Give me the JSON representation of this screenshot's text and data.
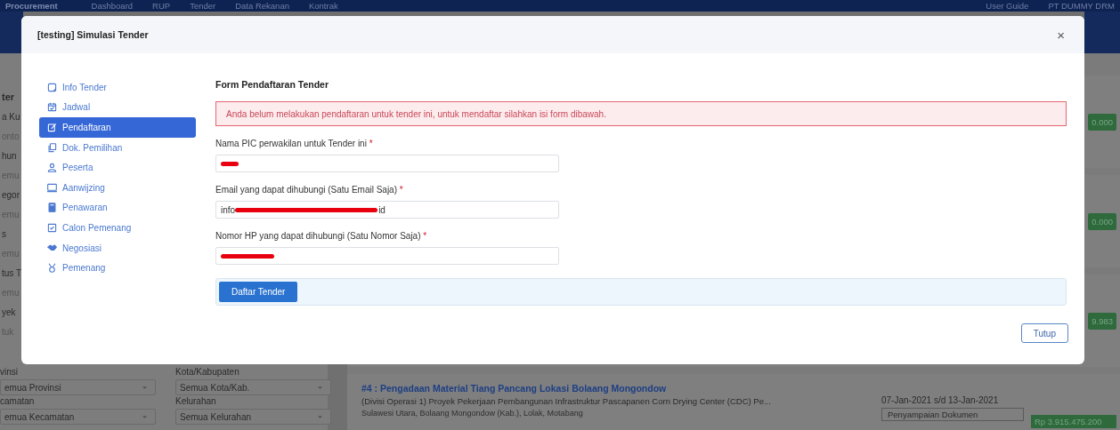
{
  "top_nav": {
    "brand": "Procurement",
    "items": [
      "Dashboard",
      "RUP",
      "Tender",
      "Data Rekanan",
      "Kontrak"
    ],
    "user_guide": "User Guide",
    "user": "PT DUMMY DRM"
  },
  "background": {
    "filter_fragments": [
      {
        "kind": "heading",
        "text": "ter"
      },
      {
        "kind": "label",
        "text": "a Ku"
      },
      {
        "kind": "field",
        "text": "onto"
      },
      {
        "kind": "label",
        "text": "hun"
      },
      {
        "kind": "field",
        "text": "emu"
      },
      {
        "kind": "label",
        "text": "egor"
      },
      {
        "kind": "field",
        "text": "emu"
      },
      {
        "kind": "label",
        "text": "s"
      },
      {
        "kind": "field",
        "text": "emu"
      },
      {
        "kind": "label",
        "text": "tus T"
      },
      {
        "kind": "field",
        "text": "emu"
      },
      {
        "kind": "label",
        "text": "yek"
      },
      {
        "kind": "field",
        "text": "tuk"
      }
    ],
    "location_filters": [
      {
        "label": "vinsi",
        "value": "emua Provinsi"
      },
      {
        "label": "Kota/Kabupaten",
        "value": "Semua Kota/Kab."
      },
      {
        "label": "camatan",
        "value": "emua Kecamatan"
      },
      {
        "label": "Kelurahan",
        "value": "Semua Kelurahan"
      }
    ],
    "price_badges": [
      "0.000",
      "0.000",
      "9.983"
    ],
    "tender_card": {
      "title": "#4 : Pengadaan Material Tiang Pancang Lokasi Bolaang Mongondow",
      "description": "(Divisi Operasi 1) Proyek Pekerjaan Pembangunan Infrastruktur Pascapanen Corn Drying Center (CDC) Pe...",
      "location": "Sulawesi Utara, Bolaang Mongondow (Kab.), Lolak, Motabang",
      "period": "07-Jan-2021 s/d 13-Jan-2021",
      "stage": "Penyampaian Dokumen",
      "price": "Rp 3.915.475.200"
    }
  },
  "modal": {
    "title": "[testing] Simulasi Tender",
    "close": "×",
    "sidebar": {
      "items": [
        {
          "label": "Info Tender",
          "selected": false
        },
        {
          "label": "Jadwal",
          "selected": false
        },
        {
          "label": "Pendaftaran",
          "selected": true
        },
        {
          "label": "Dok. Pemilihan",
          "selected": false
        },
        {
          "label": "Peserta",
          "selected": false
        },
        {
          "label": "Aanwijzing",
          "selected": false
        },
        {
          "label": "Penawaran",
          "selected": false
        },
        {
          "label": "Calon Pemenang",
          "selected": false
        },
        {
          "label": "Negosiasi",
          "selected": false
        },
        {
          "label": "Pemenang",
          "selected": false
        }
      ]
    },
    "form_title": "Form Pendaftaran Tender",
    "alert": "Anda belum melakukan pendaftaran untuk tender ini, untuk mendaftar silahkan isi form dibawah.",
    "fields": [
      {
        "label": "Nama PIC perwakilan untuk Tender ini",
        "required_mark": "*",
        "redacted": true
      },
      {
        "label": "Email yang dapat dihubungi (Satu Email Saja)",
        "required_mark": "*",
        "value_start": "info",
        "value_end": "id",
        "redacted": true
      },
      {
        "label": "Nomor HP yang dapat dihubungi (Satu Nomor Saja)",
        "required_mark": "*",
        "redacted": true
      }
    ],
    "submit_button": "Daftar Tender",
    "close_button": "Tutup"
  }
}
